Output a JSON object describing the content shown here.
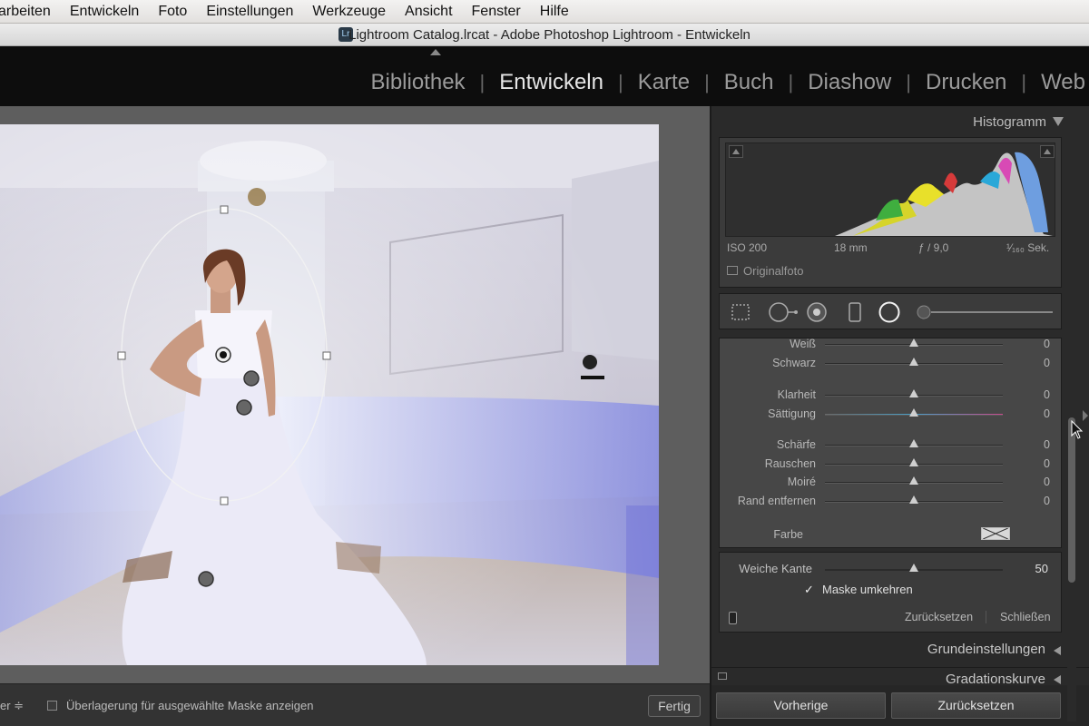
{
  "menubar": {
    "items": [
      "arbeiten",
      "Entwickeln",
      "Foto",
      "Einstellungen",
      "Werkzeuge",
      "Ansicht",
      "Fenster",
      "Hilfe"
    ]
  },
  "window": {
    "icon_text": "Lr",
    "title": "Lightroom Catalog.lrcat - Adobe Photoshop Lightroom - Entwickeln"
  },
  "modules": {
    "items": [
      "Bibliothek",
      "Entwickeln",
      "Karte",
      "Buch",
      "Diashow",
      "Drucken",
      "Web"
    ],
    "active": "Entwickeln"
  },
  "histogram": {
    "title": "Histogramm",
    "iso": "ISO 200",
    "focal": "18 mm",
    "aperture": "ƒ / 9,0",
    "shutter": "¹⁄₁₆₀ Sek.",
    "original_label": "Originalfoto"
  },
  "tools": {
    "icons": [
      "crop-icon",
      "spot-removal-icon",
      "red-eye-icon",
      "graduated-filter-icon",
      "radial-filter-icon",
      "adjustment-brush-icon"
    ],
    "active": "radial-filter-icon"
  },
  "sliders": [
    {
      "label": "Weiß",
      "value": "0"
    },
    {
      "label": "Schwarz",
      "value": "0"
    },
    {
      "label": "Klarheit",
      "value": "0"
    },
    {
      "label": "Sättigung",
      "value": "0"
    },
    {
      "label": "Schärfe",
      "value": "0"
    },
    {
      "label": "Rauschen",
      "value": "0"
    },
    {
      "label": "Moiré",
      "value": "0"
    },
    {
      "label": "Rand entfernen",
      "value": "0"
    }
  ],
  "farbe_label": "Farbe",
  "mask": {
    "feather_label": "Weiche Kante",
    "feather_value": "50",
    "feather_fraction": 0.5,
    "invert_label": "Maske umkehren",
    "invert_checked": true,
    "reset_label": "Zurücksetzen",
    "close_label": "Schließen"
  },
  "sections": {
    "basic": "Grundeinstellungen",
    "tone_curve": "Gradationskurve"
  },
  "panel_buttons": {
    "previous": "Vorherige",
    "reset": "Zurücksetzen"
  },
  "toolbar": {
    "left_text": "er ≑",
    "overlay_label": "Überlagerung für ausgewählte Maske anzeigen",
    "done": "Fertig"
  },
  "colors": {
    "background": "#2b2b2b",
    "module_bar": "#0d0d0d",
    "image_bg": "#5e5e5e",
    "accent_text": "#e6e6e6"
  }
}
